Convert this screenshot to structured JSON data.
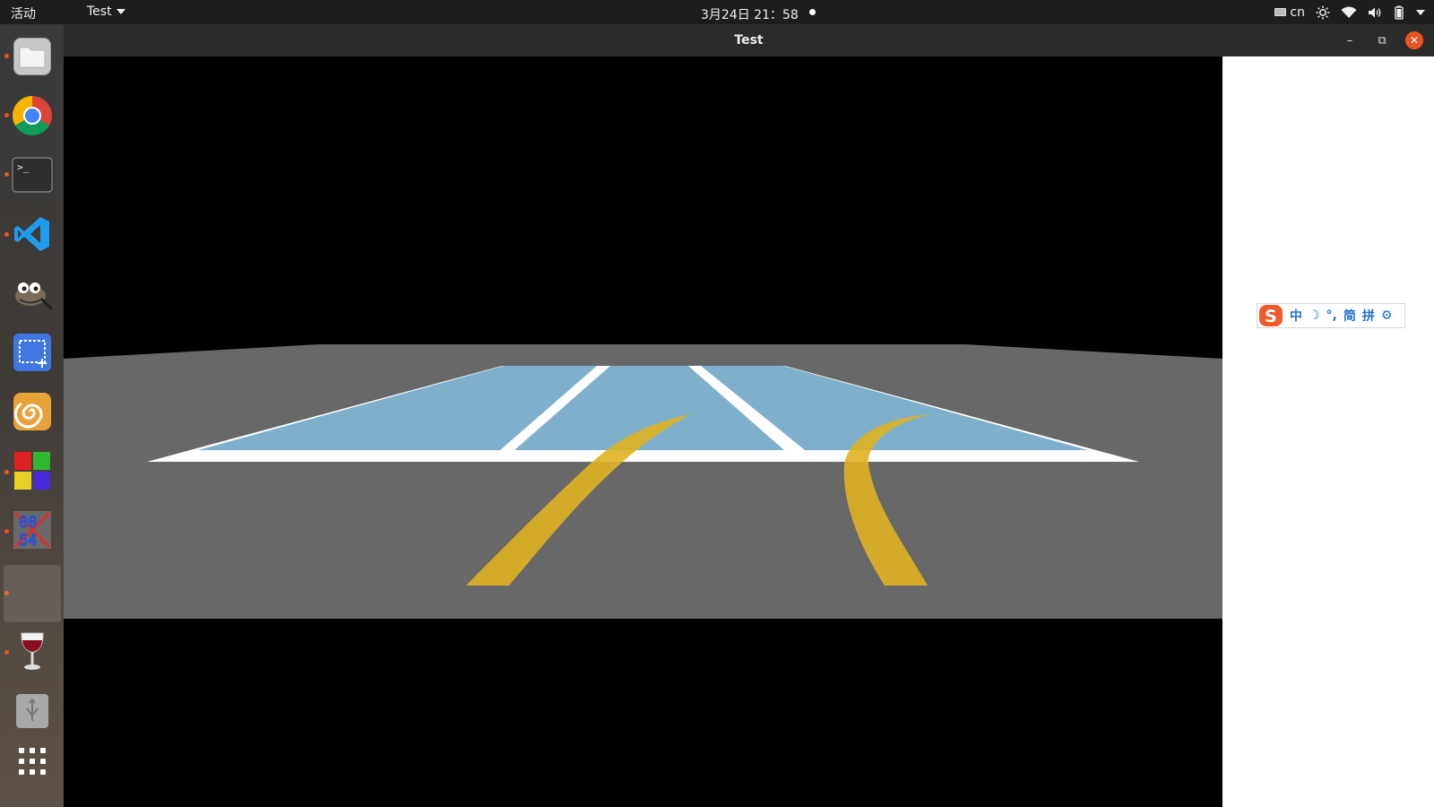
{
  "top_panel": {
    "activities": "活动",
    "app_menu": "Test",
    "clock": "3月24日 21：58",
    "input_method": "cn",
    "icons": [
      "keyboard-icon",
      "brightness-icon",
      "wifi-icon",
      "volume-icon",
      "battery-icon",
      "system-menu-caret-icon"
    ]
  },
  "dock": {
    "apps": [
      {
        "name": "files",
        "icon": "folder-icon",
        "running": true
      },
      {
        "name": "chrome",
        "icon": "chrome-icon",
        "running": true
      },
      {
        "name": "terminal",
        "icon": "terminal-icon",
        "running": true
      },
      {
        "name": "vscode",
        "icon": "vscode-icon",
        "running": true
      },
      {
        "name": "gimp",
        "icon": "gimp-icon",
        "running": false
      },
      {
        "name": "screenshot",
        "icon": "screenshot-icon",
        "running": false
      },
      {
        "name": "meld",
        "icon": "swirl-icon",
        "running": false
      },
      {
        "name": "color-tiles",
        "icon": "tiles-icon",
        "running": true
      },
      {
        "name": "char-map",
        "icon": "charmap-icon",
        "running": true
      },
      {
        "name": "test-app",
        "icon": "blank-icon",
        "running": true,
        "active": true
      },
      {
        "name": "wine",
        "icon": "wine-glass-icon",
        "running": true
      },
      {
        "name": "usb",
        "icon": "usb-icon",
        "running": false
      },
      {
        "name": "show-apps",
        "icon": "app-grid-icon",
        "running": false
      }
    ],
    "charmap_text": [
      "00",
      "54"
    ]
  },
  "window": {
    "title": "Test",
    "controls": {
      "minimize": "–",
      "maximize": "⧉",
      "close": "✕"
    }
  },
  "scene": {
    "colors": {
      "background": "#000000",
      "ground": "#686868",
      "lane_fill": "#7fb0cb",
      "lane_border": "#ffffff",
      "trajectory": "#e0b222"
    }
  },
  "ime_toolbar": {
    "logo": "S",
    "items": [
      "中",
      "☽",
      "°,",
      "简",
      "拼",
      "⚙"
    ]
  }
}
